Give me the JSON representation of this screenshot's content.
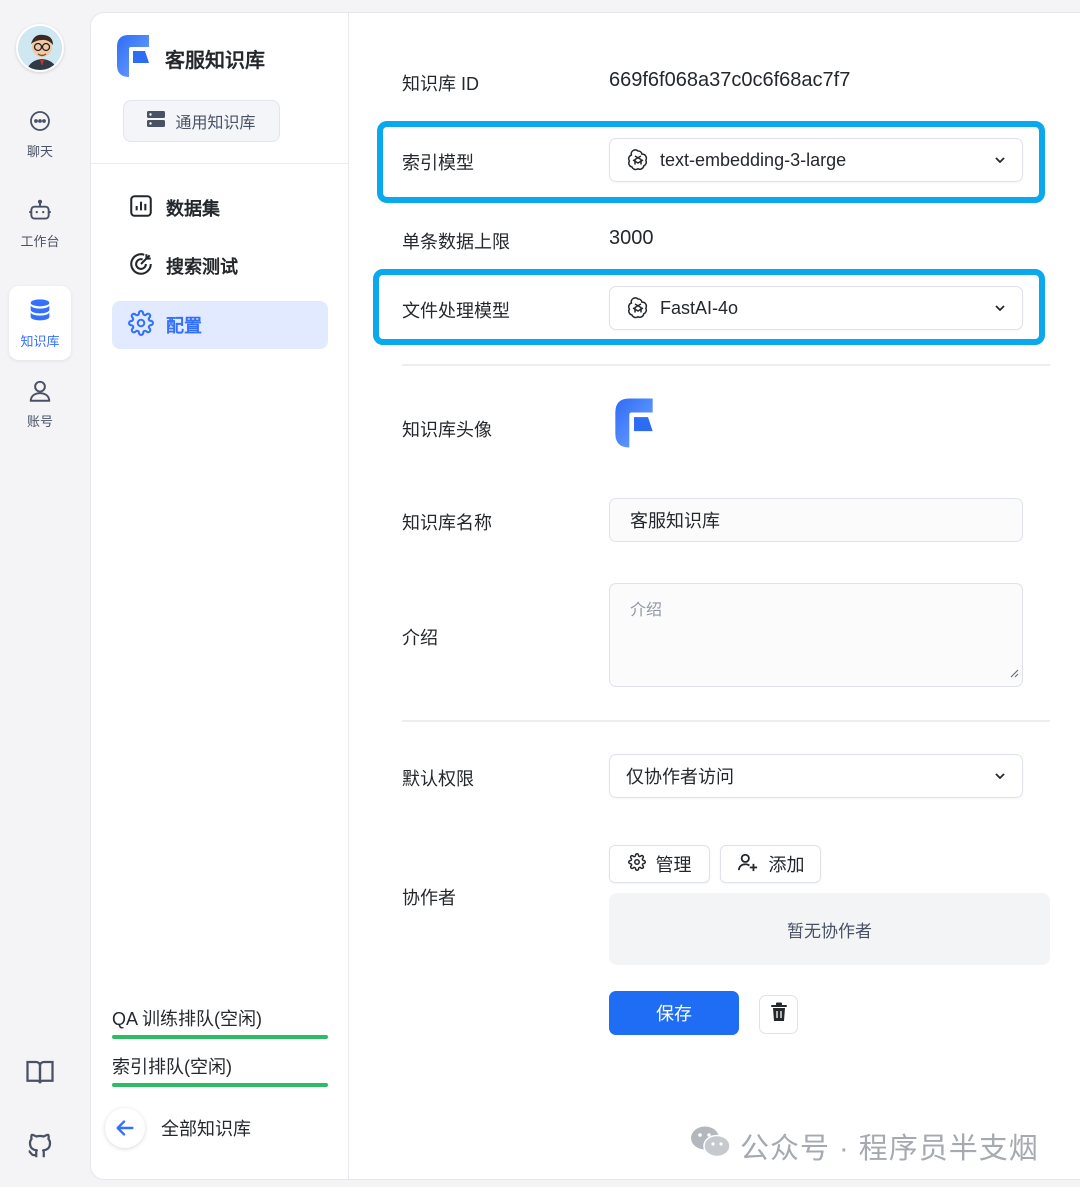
{
  "rail": {
    "items": [
      {
        "label": "聊天",
        "icon": "chat-icon"
      },
      {
        "label": "工作台",
        "icon": "robot-icon"
      },
      {
        "label": "知识库",
        "icon": "database-icon",
        "active": true
      },
      {
        "label": "账号",
        "icon": "user-icon"
      }
    ],
    "bottom_icons": [
      "book-icon",
      "github-icon"
    ]
  },
  "sidebar": {
    "kb_title": "客服知识库",
    "kb_type": "通用知识库",
    "nav": [
      {
        "label": "数据集",
        "icon": "chart-icon"
      },
      {
        "label": "搜索测试",
        "icon": "target-icon"
      },
      {
        "label": "配置",
        "icon": "gear-icon",
        "active": true
      }
    ],
    "queues": [
      {
        "label": "QA 训练排队(空闲)"
      },
      {
        "label": "索引排队(空闲)"
      }
    ],
    "back_label": "全部知识库"
  },
  "form": {
    "id_label": "知识库 ID",
    "id_value": "669f6f068a37c0c6f68ac7f7",
    "index_model_label": "索引模型",
    "index_model_value": "text-embedding-3-large",
    "max_label": "单条数据上限",
    "max_value": "3000",
    "file_model_label": "文件处理模型",
    "file_model_value": "FastAI-4o",
    "avatar_label": "知识库头像",
    "name_label": "知识库名称",
    "name_value": "客服知识库",
    "intro_label": "介绍",
    "intro_placeholder": "介绍",
    "permission_label": "默认权限",
    "permission_value": "仅协作者访问",
    "collab_label": "协作者",
    "manage_label": "管理",
    "add_label": "添加",
    "collab_empty": "暂无协作者",
    "save_label": "保存"
  },
  "watermark": "公众号 · 程序员半支烟",
  "colors": {
    "accent": "#3370ff",
    "highlight": "#0aa8ec",
    "primary_button": "#1f6df5",
    "queue_bar": "#2cbc63"
  }
}
